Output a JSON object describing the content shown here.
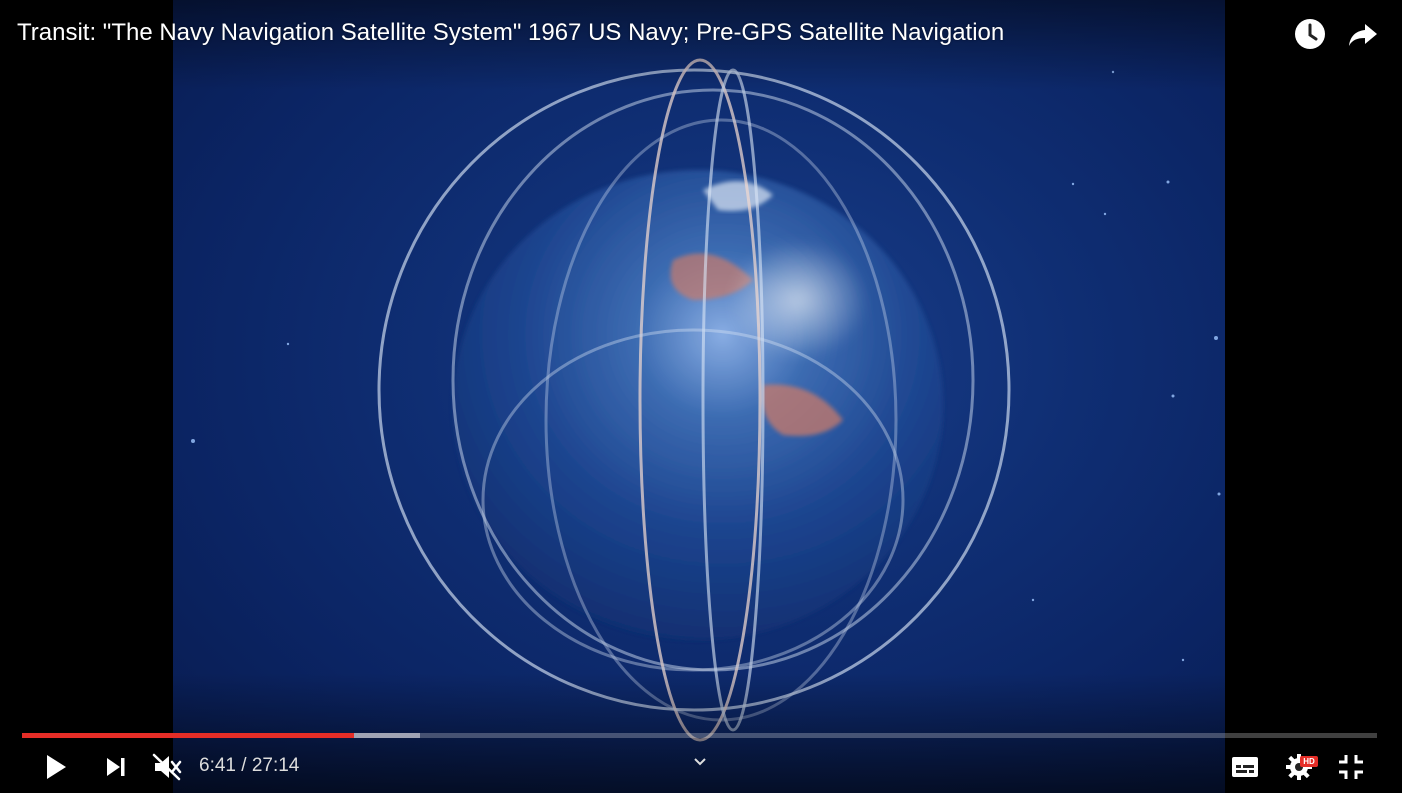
{
  "video": {
    "title": "Transit: \"The Navy Navigation Satellite System\" 1967 US Navy; Pre-GPS Satellite Navigation"
  },
  "top_actions": [
    {
      "name": "watch-later",
      "icon": "clock-icon"
    },
    {
      "name": "share",
      "icon": "share-arrow-icon"
    }
  ],
  "progress": {
    "played_fraction": 0.245,
    "buffered_fraction": 0.294,
    "played_color": "#e52d27",
    "track_color": "rgba(255,255,255,0.25)"
  },
  "controls": {
    "play_icon": "play-icon",
    "next_icon": "skip-next-icon",
    "volume_icon": "volume-muted-icon",
    "current_time": "6:41",
    "separator": " / ",
    "duration": "27:14",
    "subtitles_icon": "subtitles-icon",
    "settings_icon": "gear-icon",
    "hd_badge": "HD",
    "hd_badge_color": "#e52d27",
    "exit_fullscreen_icon": "exit-fullscreen-icon",
    "chevron_icon": "chevron-down-icon"
  }
}
